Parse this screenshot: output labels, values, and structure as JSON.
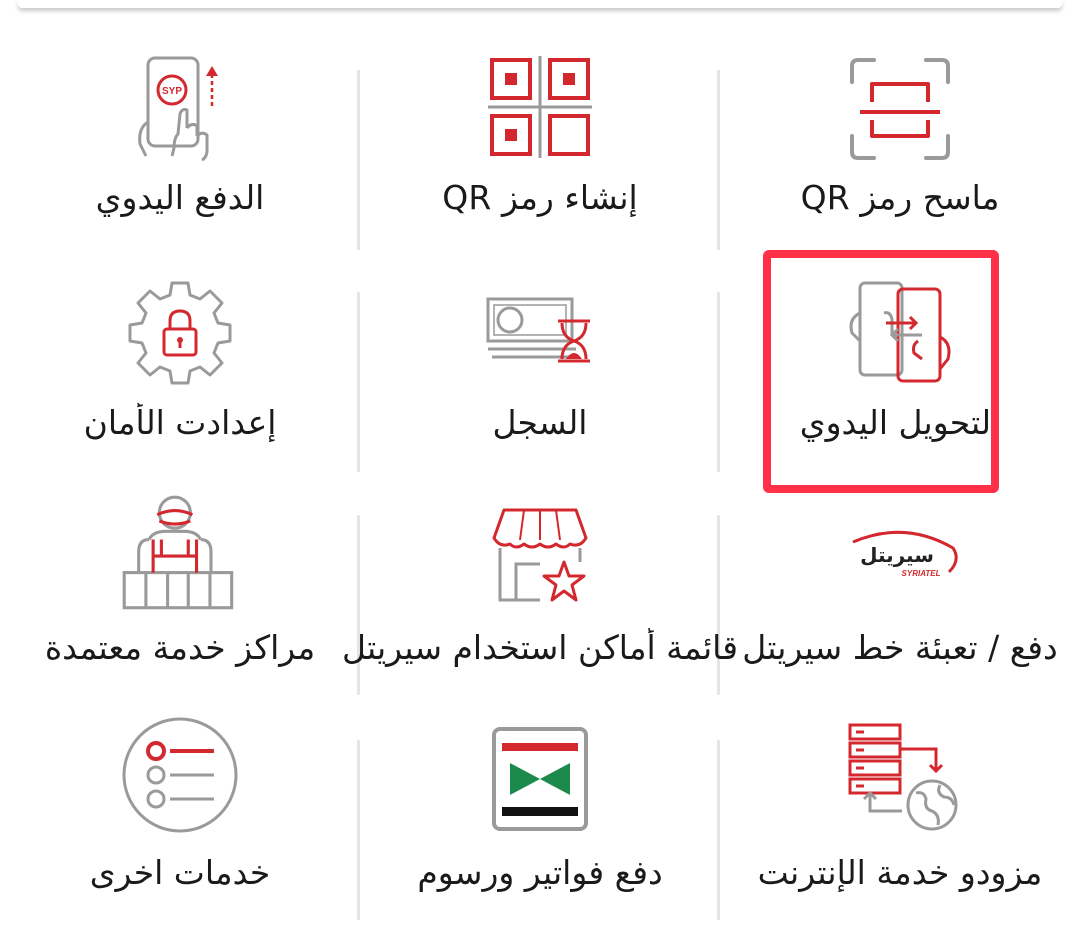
{
  "services": [
    {
      "id": "qr-scanner",
      "label": "ماسح رمز QR",
      "icon": "qr-scanner-icon"
    },
    {
      "id": "create-qr",
      "label": "إنشاء رمز QR",
      "icon": "qr-code-icon"
    },
    {
      "id": "manual-payment",
      "label": "الدفع اليدوي",
      "icon": "phone-tap-syp-icon",
      "icon_text": "SYP"
    },
    {
      "id": "manual-transfer",
      "label": "التحويل اليدوي",
      "icon": "phone-transfer-icon"
    },
    {
      "id": "history",
      "label": "السجل",
      "icon": "money-hourglass-icon"
    },
    {
      "id": "security-settings",
      "label": "إعدادت الأمان",
      "icon": "gear-lock-icon"
    },
    {
      "id": "syriatel-topup",
      "label": "دفع / تعبئة خط سيريتل",
      "icon": "syriatel-logo-icon",
      "logo_text": "سيريتل",
      "logo_subtext": "SYRIATEL"
    },
    {
      "id": "usage-places",
      "label": "قائمة أماكن استخدام سيريتل",
      "icon": "store-star-icon"
    },
    {
      "id": "service-centers",
      "label": "مراكز خدمة معتمدة",
      "icon": "service-agent-icon"
    },
    {
      "id": "internet-providers",
      "label": "مزودو خدمة الإنترنت",
      "icon": "server-globe-icon"
    },
    {
      "id": "bills-fees",
      "label": "دفع فواتير ورسوم",
      "icon": "flag-bills-icon"
    },
    {
      "id": "other-services",
      "label": "خدمات اخرى",
      "icon": "list-menu-icon"
    }
  ],
  "colors": {
    "accent": "#d4282f",
    "icon_gray": "#9a9a9a",
    "highlight": "#ff3047",
    "flag_green": "#1b8a4a"
  }
}
